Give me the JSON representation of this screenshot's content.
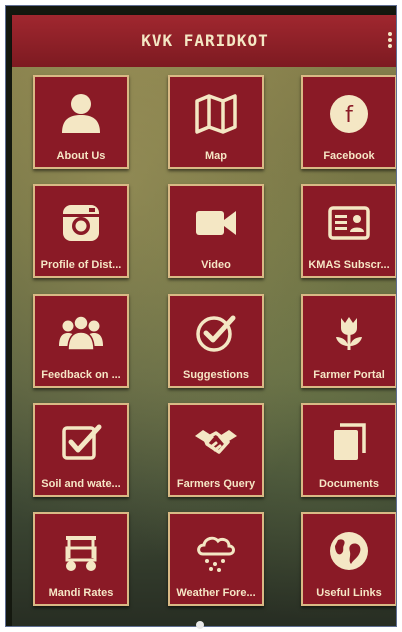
{
  "app": {
    "title": "KVK FARIDKOT",
    "icon_color": "#f4e7c4",
    "tile_color": "#8a1a26"
  },
  "tiles": [
    {
      "label": "About Us",
      "icon": "person-icon"
    },
    {
      "label": "Map",
      "icon": "map-icon"
    },
    {
      "label": "Facebook",
      "icon": "facebook-icon"
    },
    {
      "label": "Profile of Dist...",
      "icon": "instagram-camera-icon"
    },
    {
      "label": "Video",
      "icon": "video-camera-icon"
    },
    {
      "label": "KMAS Subscr...",
      "icon": "id-card-icon"
    },
    {
      "label": "Feedback on ...",
      "icon": "people-group-icon"
    },
    {
      "label": "Suggestions",
      "icon": "check-circle-icon"
    },
    {
      "label": "Farmer Portal",
      "icon": "tulip-icon"
    },
    {
      "label": "Soil and wate...",
      "icon": "checkbox-icon"
    },
    {
      "label": "Farmers Query",
      "icon": "handshake-icon"
    },
    {
      "label": "Documents",
      "icon": "documents-icon"
    },
    {
      "label": "Mandi Rates",
      "icon": "cart-icon"
    },
    {
      "label": "Weather Fore...",
      "icon": "weather-snow-cloud-icon"
    },
    {
      "label": "Useful Links",
      "icon": "globe-icon"
    }
  ]
}
